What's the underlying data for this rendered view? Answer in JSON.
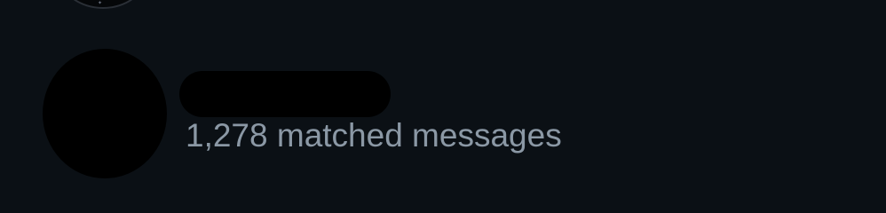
{
  "previous_item": {
    "avatar_icon": "avatar-icon"
  },
  "search_result": {
    "avatar_icon": "avatar-icon",
    "display_name": "",
    "display_name_redacted": true,
    "matched_messages": "1,278 matched messages"
  },
  "colors": {
    "background": "#0b1015",
    "secondary_text": "#8b98a5",
    "redaction": "#000000"
  }
}
